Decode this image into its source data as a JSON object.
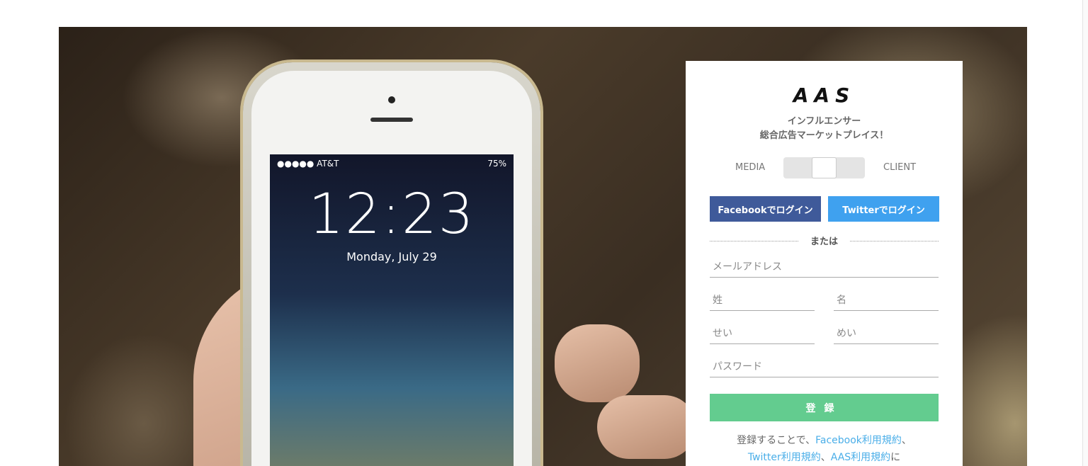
{
  "phone_screen": {
    "carrier": "●●●●● AT&T",
    "battery": "75%",
    "time": "12:23",
    "date": "Monday, July 29"
  },
  "panel": {
    "logo": "AAS",
    "tagline_line1": "インフルエンサー",
    "tagline_line2": "総合広告マーケットプレイス！",
    "toggle": {
      "left_label": "MEDIA",
      "right_label": "CLIENT"
    },
    "facebook_login": "Facebookでログイン",
    "twitter_login": "Twitterでログイン",
    "divider": "または",
    "fields": {
      "email_placeholder": "メールアドレス",
      "last_name_placeholder": "姓",
      "first_name_placeholder": "名",
      "last_kana_placeholder": "せい",
      "first_kana_placeholder": "めい",
      "password_placeholder": "パスワード"
    },
    "submit": "登録",
    "terms": {
      "prefix": "登録することで、",
      "fb_link": "Facebook利用規約",
      "sep1": "、",
      "tw_link": "Twitter利用規約",
      "sep2": "、",
      "aas_link": "AAS利用規約",
      "suffix": "に"
    },
    "colors": {
      "facebook": "#3f5a9a",
      "twitter": "#3fa1ef",
      "submit": "#63cc8f",
      "link": "#4aaee8"
    }
  }
}
